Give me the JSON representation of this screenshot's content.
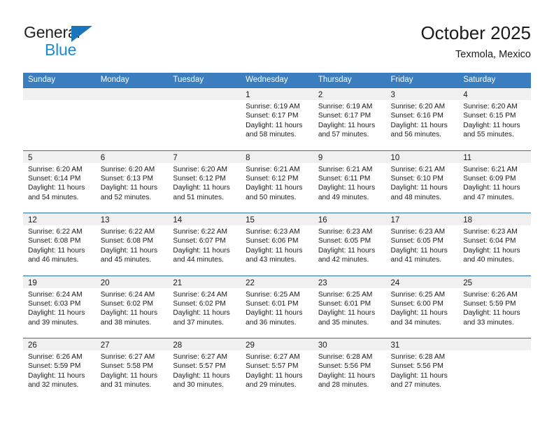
{
  "brand": {
    "name_line1": "General",
    "name_line2": "Blue",
    "flag_icon": "triangle-flag-icon",
    "colors": {
      "dark": "#231f20",
      "blue": "#1b8ad4",
      "flag": "#1b75bb"
    }
  },
  "header": {
    "title": "October 2025",
    "subtitle": "Texmola, Mexico"
  },
  "theme": {
    "header_bar": "#3a7ebf",
    "row_divider": "#2f6fae",
    "daynum_strip": "#f0f0f0",
    "text": "#1a1a1a"
  },
  "weekdays": [
    "Sunday",
    "Monday",
    "Tuesday",
    "Wednesday",
    "Thursday",
    "Friday",
    "Saturday"
  ],
  "weeks": [
    [
      {
        "day": "",
        "sunrise": "",
        "sunset": "",
        "daylight1": "",
        "daylight2": ""
      },
      {
        "day": "",
        "sunrise": "",
        "sunset": "",
        "daylight1": "",
        "daylight2": ""
      },
      {
        "day": "",
        "sunrise": "",
        "sunset": "",
        "daylight1": "",
        "daylight2": ""
      },
      {
        "day": "1",
        "sunrise": "Sunrise: 6:19 AM",
        "sunset": "Sunset: 6:17 PM",
        "daylight1": "Daylight: 11 hours",
        "daylight2": "and 58 minutes."
      },
      {
        "day": "2",
        "sunrise": "Sunrise: 6:19 AM",
        "sunset": "Sunset: 6:17 PM",
        "daylight1": "Daylight: 11 hours",
        "daylight2": "and 57 minutes."
      },
      {
        "day": "3",
        "sunrise": "Sunrise: 6:20 AM",
        "sunset": "Sunset: 6:16 PM",
        "daylight1": "Daylight: 11 hours",
        "daylight2": "and 56 minutes."
      },
      {
        "day": "4",
        "sunrise": "Sunrise: 6:20 AM",
        "sunset": "Sunset: 6:15 PM",
        "daylight1": "Daylight: 11 hours",
        "daylight2": "and 55 minutes."
      }
    ],
    [
      {
        "day": "5",
        "sunrise": "Sunrise: 6:20 AM",
        "sunset": "Sunset: 6:14 PM",
        "daylight1": "Daylight: 11 hours",
        "daylight2": "and 54 minutes."
      },
      {
        "day": "6",
        "sunrise": "Sunrise: 6:20 AM",
        "sunset": "Sunset: 6:13 PM",
        "daylight1": "Daylight: 11 hours",
        "daylight2": "and 52 minutes."
      },
      {
        "day": "7",
        "sunrise": "Sunrise: 6:20 AM",
        "sunset": "Sunset: 6:12 PM",
        "daylight1": "Daylight: 11 hours",
        "daylight2": "and 51 minutes."
      },
      {
        "day": "8",
        "sunrise": "Sunrise: 6:21 AM",
        "sunset": "Sunset: 6:12 PM",
        "daylight1": "Daylight: 11 hours",
        "daylight2": "and 50 minutes."
      },
      {
        "day": "9",
        "sunrise": "Sunrise: 6:21 AM",
        "sunset": "Sunset: 6:11 PM",
        "daylight1": "Daylight: 11 hours",
        "daylight2": "and 49 minutes."
      },
      {
        "day": "10",
        "sunrise": "Sunrise: 6:21 AM",
        "sunset": "Sunset: 6:10 PM",
        "daylight1": "Daylight: 11 hours",
        "daylight2": "and 48 minutes."
      },
      {
        "day": "11",
        "sunrise": "Sunrise: 6:21 AM",
        "sunset": "Sunset: 6:09 PM",
        "daylight1": "Daylight: 11 hours",
        "daylight2": "and 47 minutes."
      }
    ],
    [
      {
        "day": "12",
        "sunrise": "Sunrise: 6:22 AM",
        "sunset": "Sunset: 6:08 PM",
        "daylight1": "Daylight: 11 hours",
        "daylight2": "and 46 minutes."
      },
      {
        "day": "13",
        "sunrise": "Sunrise: 6:22 AM",
        "sunset": "Sunset: 6:08 PM",
        "daylight1": "Daylight: 11 hours",
        "daylight2": "and 45 minutes."
      },
      {
        "day": "14",
        "sunrise": "Sunrise: 6:22 AM",
        "sunset": "Sunset: 6:07 PM",
        "daylight1": "Daylight: 11 hours",
        "daylight2": "and 44 minutes."
      },
      {
        "day": "15",
        "sunrise": "Sunrise: 6:23 AM",
        "sunset": "Sunset: 6:06 PM",
        "daylight1": "Daylight: 11 hours",
        "daylight2": "and 43 minutes."
      },
      {
        "day": "16",
        "sunrise": "Sunrise: 6:23 AM",
        "sunset": "Sunset: 6:05 PM",
        "daylight1": "Daylight: 11 hours",
        "daylight2": "and 42 minutes."
      },
      {
        "day": "17",
        "sunrise": "Sunrise: 6:23 AM",
        "sunset": "Sunset: 6:05 PM",
        "daylight1": "Daylight: 11 hours",
        "daylight2": "and 41 minutes."
      },
      {
        "day": "18",
        "sunrise": "Sunrise: 6:23 AM",
        "sunset": "Sunset: 6:04 PM",
        "daylight1": "Daylight: 11 hours",
        "daylight2": "and 40 minutes."
      }
    ],
    [
      {
        "day": "19",
        "sunrise": "Sunrise: 6:24 AM",
        "sunset": "Sunset: 6:03 PM",
        "daylight1": "Daylight: 11 hours",
        "daylight2": "and 39 minutes."
      },
      {
        "day": "20",
        "sunrise": "Sunrise: 6:24 AM",
        "sunset": "Sunset: 6:02 PM",
        "daylight1": "Daylight: 11 hours",
        "daylight2": "and 38 minutes."
      },
      {
        "day": "21",
        "sunrise": "Sunrise: 6:24 AM",
        "sunset": "Sunset: 6:02 PM",
        "daylight1": "Daylight: 11 hours",
        "daylight2": "and 37 minutes."
      },
      {
        "day": "22",
        "sunrise": "Sunrise: 6:25 AM",
        "sunset": "Sunset: 6:01 PM",
        "daylight1": "Daylight: 11 hours",
        "daylight2": "and 36 minutes."
      },
      {
        "day": "23",
        "sunrise": "Sunrise: 6:25 AM",
        "sunset": "Sunset: 6:01 PM",
        "daylight1": "Daylight: 11 hours",
        "daylight2": "and 35 minutes."
      },
      {
        "day": "24",
        "sunrise": "Sunrise: 6:25 AM",
        "sunset": "Sunset: 6:00 PM",
        "daylight1": "Daylight: 11 hours",
        "daylight2": "and 34 minutes."
      },
      {
        "day": "25",
        "sunrise": "Sunrise: 6:26 AM",
        "sunset": "Sunset: 5:59 PM",
        "daylight1": "Daylight: 11 hours",
        "daylight2": "and 33 minutes."
      }
    ],
    [
      {
        "day": "26",
        "sunrise": "Sunrise: 6:26 AM",
        "sunset": "Sunset: 5:59 PM",
        "daylight1": "Daylight: 11 hours",
        "daylight2": "and 32 minutes."
      },
      {
        "day": "27",
        "sunrise": "Sunrise: 6:27 AM",
        "sunset": "Sunset: 5:58 PM",
        "daylight1": "Daylight: 11 hours",
        "daylight2": "and 31 minutes."
      },
      {
        "day": "28",
        "sunrise": "Sunrise: 6:27 AM",
        "sunset": "Sunset: 5:57 PM",
        "daylight1": "Daylight: 11 hours",
        "daylight2": "and 30 minutes."
      },
      {
        "day": "29",
        "sunrise": "Sunrise: 6:27 AM",
        "sunset": "Sunset: 5:57 PM",
        "daylight1": "Daylight: 11 hours",
        "daylight2": "and 29 minutes."
      },
      {
        "day": "30",
        "sunrise": "Sunrise: 6:28 AM",
        "sunset": "Sunset: 5:56 PM",
        "daylight1": "Daylight: 11 hours",
        "daylight2": "and 28 minutes."
      },
      {
        "day": "31",
        "sunrise": "Sunrise: 6:28 AM",
        "sunset": "Sunset: 5:56 PM",
        "daylight1": "Daylight: 11 hours",
        "daylight2": "and 27 minutes."
      },
      {
        "day": "",
        "sunrise": "",
        "sunset": "",
        "daylight1": "",
        "daylight2": ""
      }
    ]
  ]
}
